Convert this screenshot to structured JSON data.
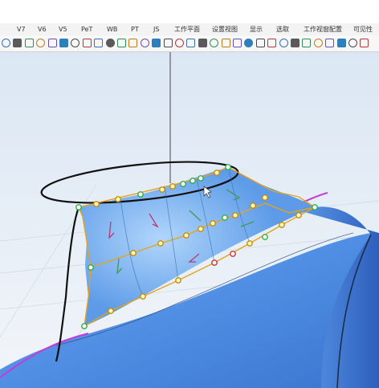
{
  "app": {
    "tabs": [
      "V7",
      "V6",
      "V5",
      "PeT",
      "WB",
      "PT",
      "JS",
      "工作平面",
      "设置视图",
      "显示",
      "选取",
      "工作视窗配置",
      "可见性"
    ]
  },
  "toolbar": {
    "icons": [
      "circle-icon",
      "gear-icon",
      "cylinder-icon",
      "move-icon",
      "plane-icon",
      "surface-icon",
      "gear-icon",
      "grid-icon",
      "sphere-icon",
      "square-icon",
      "plus-icon",
      "box-icon",
      "shape-icon",
      "cube-icon",
      "render-icon",
      "scale-icon",
      "point-icon",
      "curve-icon",
      "pen-icon",
      "bend-icon",
      "ball-icon",
      "box-icon",
      "palette-icon",
      "ring-icon",
      "light-icon",
      "pencil-icon",
      "bucket-icon",
      "arc-icon",
      "flip-icon",
      "person-icon",
      "grid-icon",
      "globe-icon"
    ]
  },
  "viewport": {
    "background_top": "#dde8f4",
    "background_bottom": "#f4f6f9",
    "surface_color": "#5c9ae8",
    "cage_color": "#e6a21a",
    "point_fill": "#ffffb3",
    "selected_point_color": "#2fae45",
    "red_point_color": "#d3322e",
    "seam_color": "#c43bd6"
  }
}
